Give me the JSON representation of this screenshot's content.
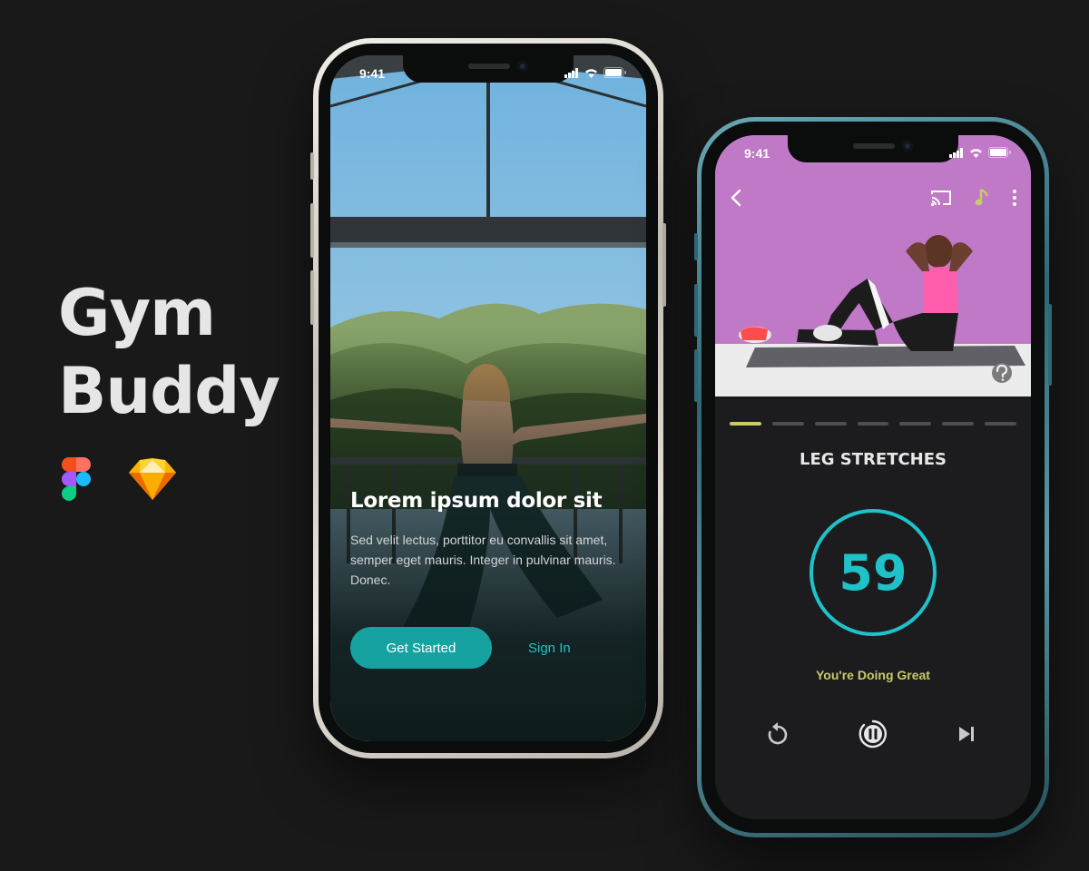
{
  "brand": {
    "title_line1": "Gym",
    "title_line2": "Buddy",
    "tools": [
      "figma-icon",
      "sketch-icon"
    ]
  },
  "onboarding_screen": {
    "status_time": "9:41",
    "heading": "Lorem ipsum dolor sit",
    "description": "Sed velit lectus, porttitor eu convallis sit amet, semper eget mauris. Integer in pulvinar mauris. Donec.",
    "primary_button": "Get Started",
    "secondary_link": "Sign In"
  },
  "workout_screen": {
    "status_time": "9:41",
    "top_icons": [
      "back-icon",
      "cast-icon",
      "music-note-icon",
      "more-vertical-icon",
      "help-icon"
    ],
    "exercise_name": "LEG STRETCHES",
    "timer_seconds": "59",
    "timer_progress": 1.0,
    "progress": {
      "total_steps": 7,
      "current_step": 1
    },
    "encouragement": "You're Doing Great",
    "controls": [
      "restart-icon",
      "pause-icon",
      "skip-next-icon"
    ]
  },
  "colors": {
    "background": "#19191a",
    "accent_teal": "#17a2a2",
    "timer_teal": "#1ec2c8",
    "accent_yellow": "#c7cb66",
    "video_bg": "#c079c6"
  }
}
